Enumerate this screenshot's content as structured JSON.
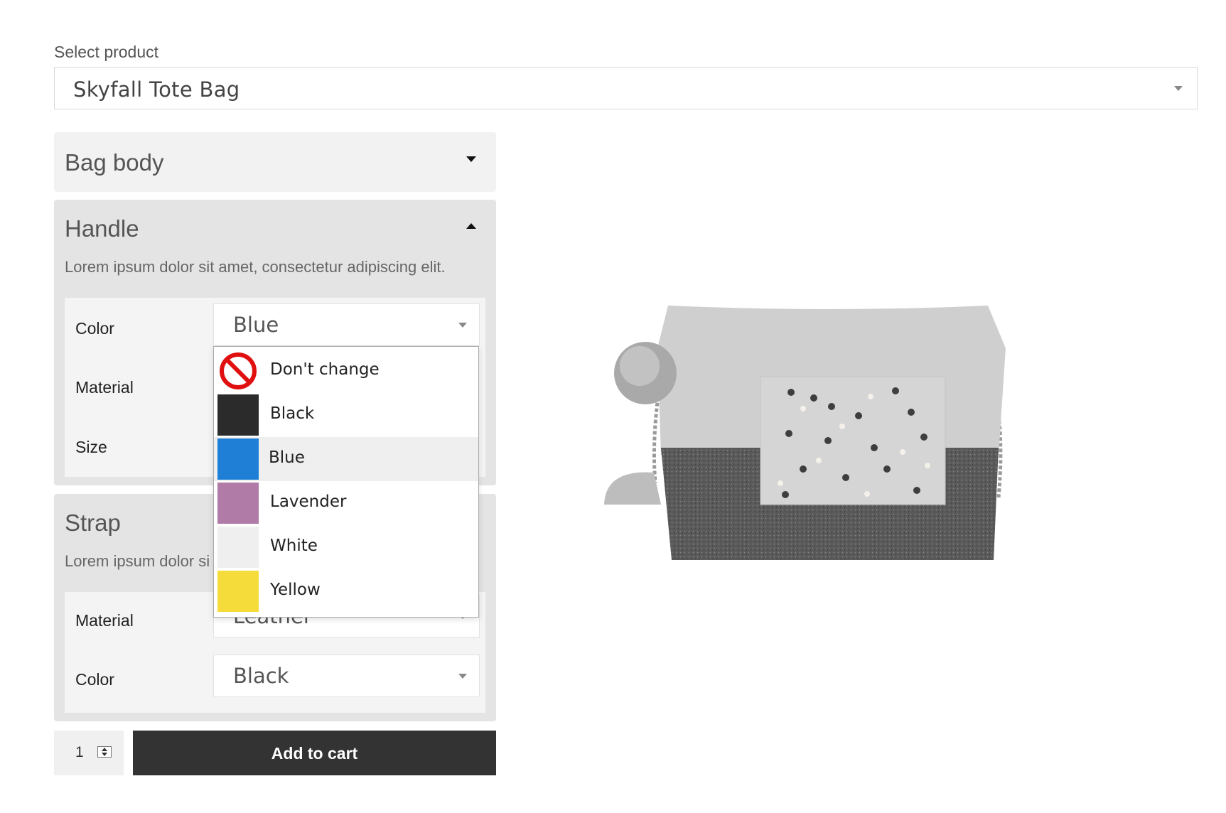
{
  "product_selector": {
    "label": "Select product",
    "value": "Skyfall Tote Bag"
  },
  "sections": {
    "bag_body": {
      "title": "Bag body",
      "expanded": false
    },
    "handle": {
      "title": "Handle",
      "expanded": true,
      "description": "Lorem ipsum dolor sit amet, consectetur adipiscing elit.",
      "fields": [
        {
          "label": "Color",
          "value": "Blue"
        },
        {
          "label": "Material"
        },
        {
          "label": "Size"
        }
      ]
    },
    "strap": {
      "title": "Strap",
      "expanded": true,
      "description": "Lorem ipsum dolor si",
      "fields": [
        {
          "label": "Material",
          "value": "Leather"
        },
        {
          "label": "Color",
          "value": "Black"
        }
      ]
    }
  },
  "color_dropdown": {
    "selected": "Blue",
    "options": [
      {
        "label": "Don't change",
        "icon": "no-entry-icon"
      },
      {
        "label": "Black",
        "color": "#2b2b2b"
      },
      {
        "label": "Blue",
        "color": "#1f7fd6"
      },
      {
        "label": "Lavender",
        "color": "#b07ba6"
      },
      {
        "label": "White",
        "color": "#efefef"
      },
      {
        "label": "Yellow",
        "color": "#f5dc3a"
      }
    ]
  },
  "cart": {
    "quantity": "1",
    "add_label": "Add to cart"
  },
  "colors": {
    "panel_bg": "#f2f2f2",
    "panel_expanded_bg": "#e4e4e4",
    "button_bg": "#333333"
  }
}
